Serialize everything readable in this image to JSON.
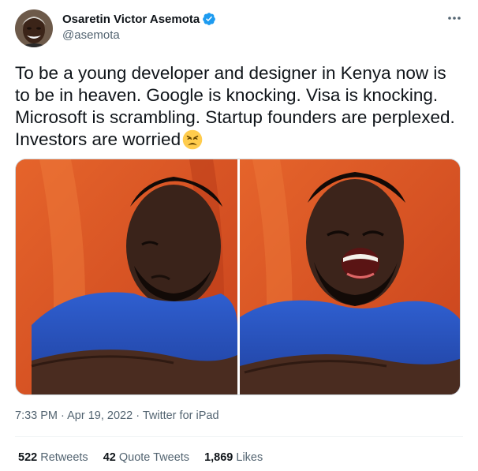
{
  "author": {
    "display_name": "Osaretin Victor Asemota",
    "handle": "@asemota",
    "verified": true,
    "avatar_icon": "profile-photo"
  },
  "tweet": {
    "text": "To be a young developer and designer in Kenya now is to be in heaven. Google is knocking. Visa is knocking. Microsoft is scrambling. Startup founders are perplexed. Investors are worried",
    "emoji": "weary-face-emoji",
    "time": "7:33 PM",
    "separator": "·",
    "date": "Apr 19, 2022",
    "source": "Twitter for iPad"
  },
  "stats": {
    "retweets_count": "522",
    "retweets_label": "Retweets",
    "quotes_count": "42",
    "quotes_label": "Quote Tweets",
    "likes_count": "1,869",
    "likes_label": "Likes"
  },
  "media": {
    "type": "two-panel reaction image"
  },
  "colors": {
    "text": "#0f1419",
    "secondary": "#536471",
    "verified": "#1d9bf0",
    "divider": "#eff3f4"
  }
}
